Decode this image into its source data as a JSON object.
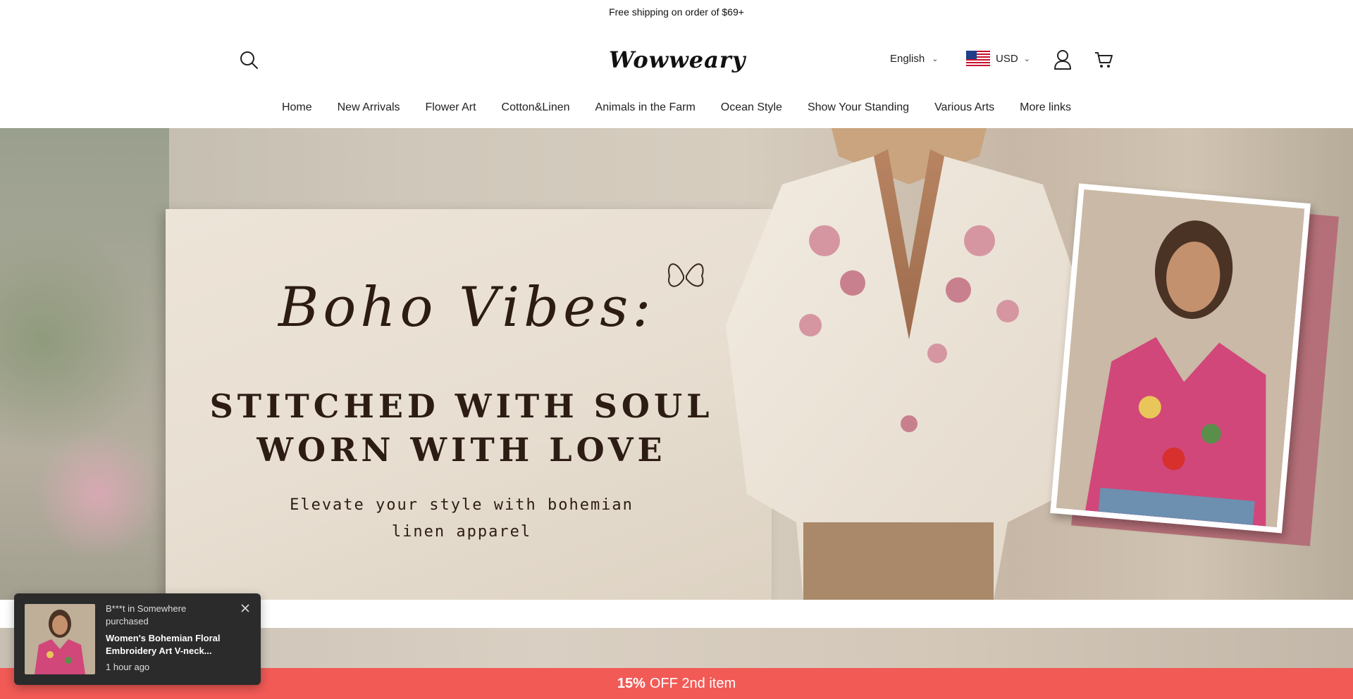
{
  "announcement": {
    "text": "Free shipping on order of $69+"
  },
  "header": {
    "logo_text": "Wowweary",
    "language": "English",
    "currency": "USD"
  },
  "nav": {
    "items": [
      "Home",
      "New Arrivals",
      "Flower Art",
      "Cotton&Linen",
      "Animals in the Farm",
      "Ocean Style",
      "Show Your Standing",
      "Various Arts",
      "More links"
    ]
  },
  "hero": {
    "script_title": "Boho Vibes:",
    "headline_line1": "STITCHED WITH SOUL",
    "headline_line2": "WORN WITH LOVE",
    "subtitle": "Elevate your style with bohemian linen apparel"
  },
  "popup": {
    "who": "B***t in Somewhere purchased",
    "product": "Women's Bohemian Floral Embroidery Art V-neck...",
    "time": "1 hour ago"
  },
  "promo": {
    "bold": "15%",
    "rest": "OFF 2nd item"
  },
  "colors": {
    "promo_bg": "#f25a56",
    "popup_bg": "#2b2b2b",
    "hero_text": "#2d1c14"
  },
  "icons": [
    "search-icon",
    "chevron-down-icon",
    "us-flag-icon",
    "user-icon",
    "cart-icon",
    "close-icon",
    "butterfly-icon"
  ]
}
